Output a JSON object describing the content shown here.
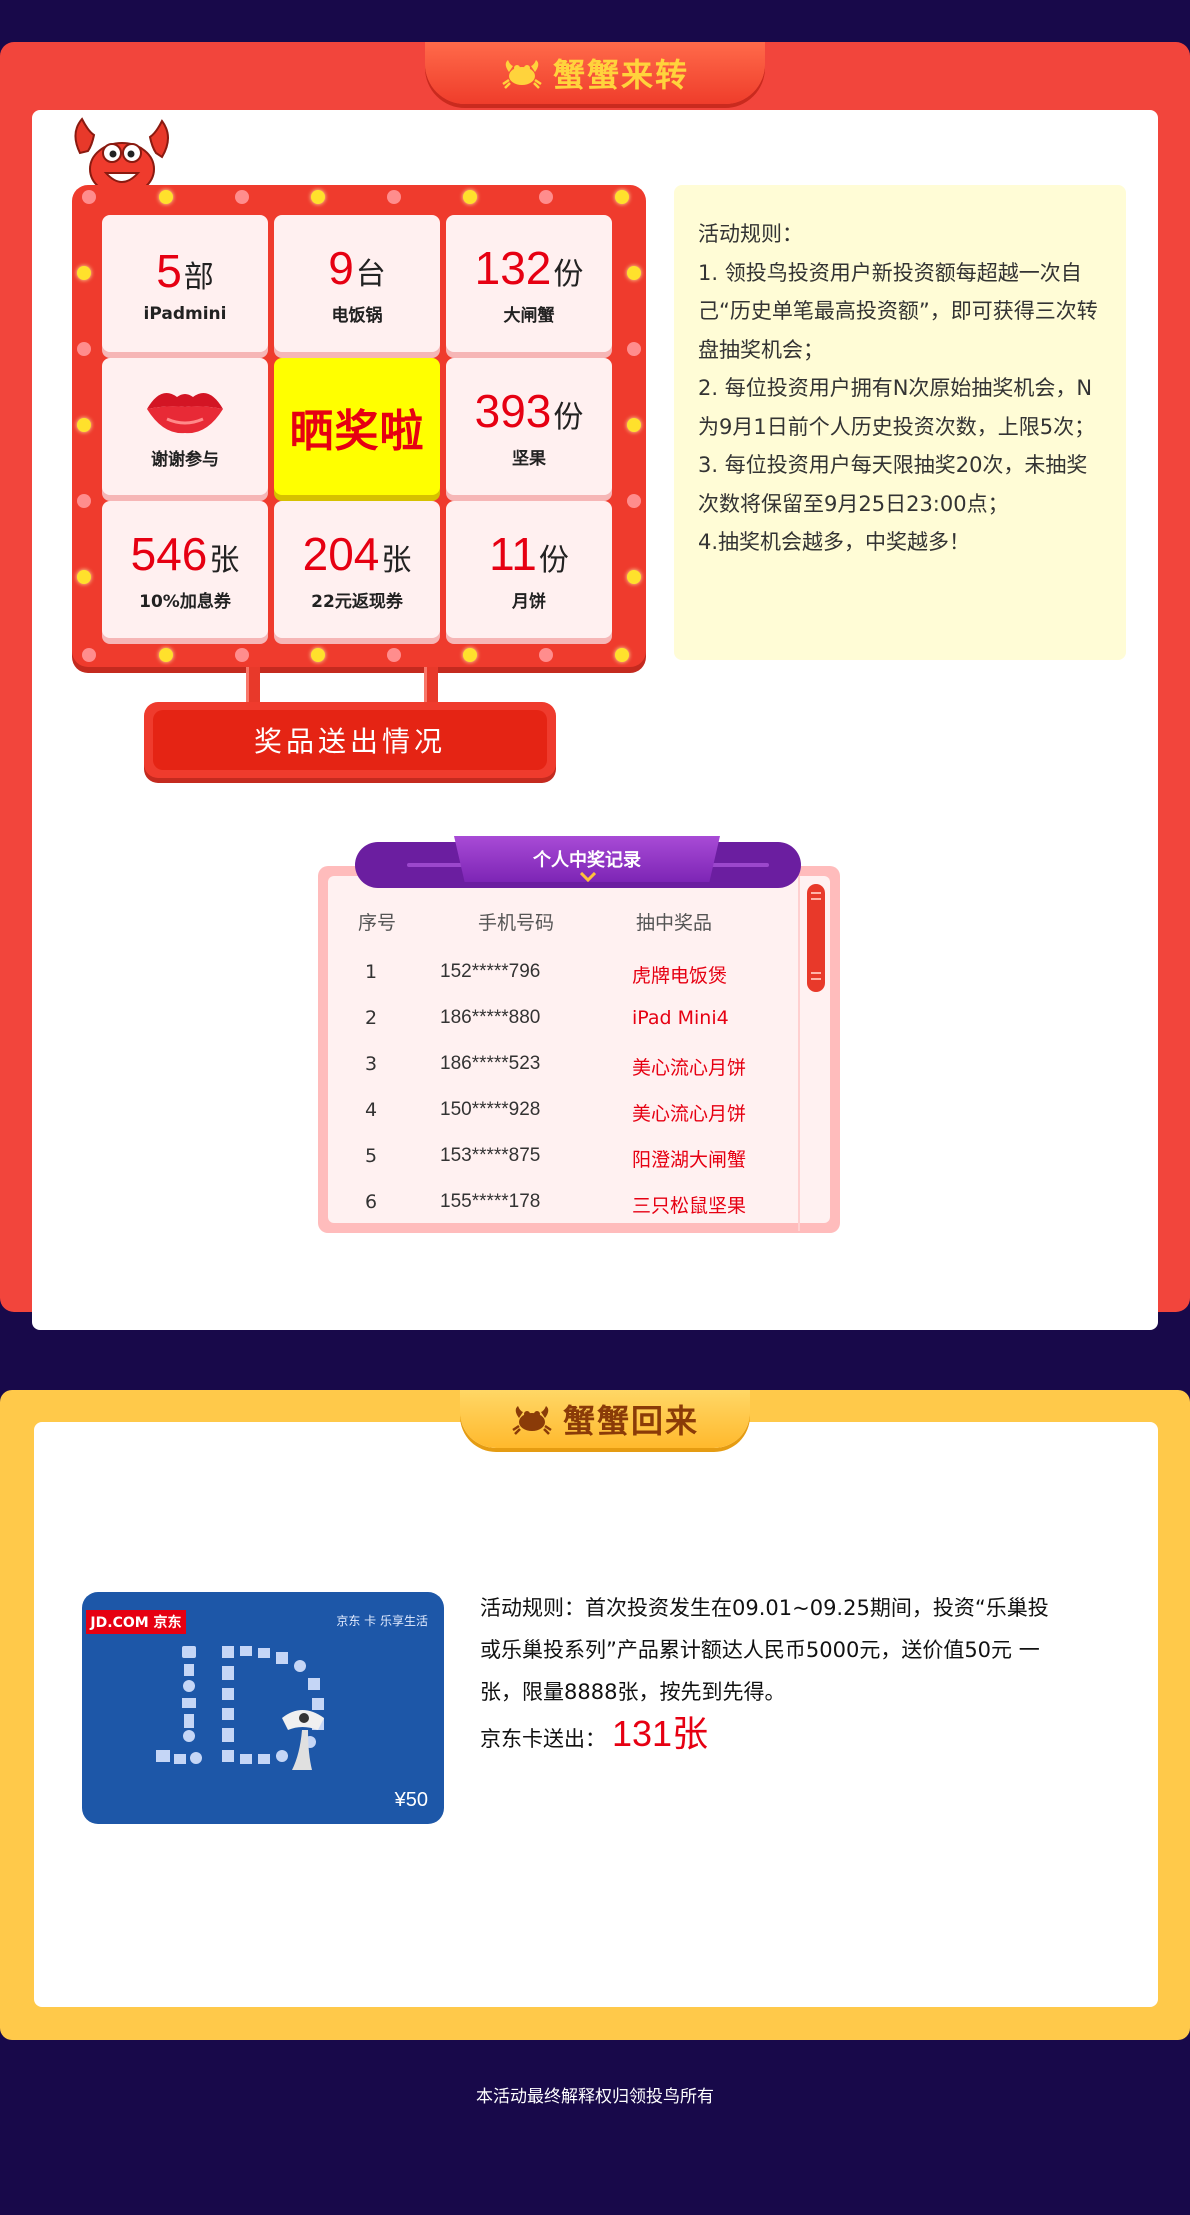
{
  "section1": {
    "title": "蟹蟹来转",
    "prizes": [
      {
        "num": "5",
        "unit": "部",
        "name": "iPadmini"
      },
      {
        "num": "9",
        "unit": "台",
        "name": "电饭锅"
      },
      {
        "num": "132",
        "unit": "份",
        "name": "大闸蟹"
      },
      {
        "num": "",
        "unit": "",
        "name": "谢谢参与",
        "icon": "lips-icon"
      },
      {
        "center": "晒奖啦"
      },
      {
        "num": "393",
        "unit": "份",
        "name": "坚果"
      },
      {
        "num": "546",
        "unit": "张",
        "name": "10%加息券"
      },
      {
        "num": "204",
        "unit": "张",
        "name": "22元返现券"
      },
      {
        "num": "11",
        "unit": "份",
        "name": "月饼"
      }
    ],
    "prize_button": "奖品送出情况",
    "rules": {
      "heading": "活动规则：",
      "items": [
        "1. 领投鸟投资用户新投资额每超越一次自己“历史单笔最高投资额”，即可获得三次转盘抽奖机会；",
        "2. 每位投资用户拥有N次原始抽奖机会，N为9月1日前个人历史投资次数，上限5次；",
        "3. 每位投资用户每天限抽奖20次，未抽奖次数将保留至9月25日23:00点；",
        "4.抽奖机会越多，中奖越多！"
      ]
    },
    "records": {
      "title": "个人中奖记录",
      "columns": [
        "序号",
        "手机号码",
        "抽中奖品"
      ],
      "rows": [
        {
          "idx": "1",
          "phone": "152*****796",
          "prize": "虎牌电饭煲"
        },
        {
          "idx": "2",
          "phone": "186*****880",
          "prize": "iPad Mini4"
        },
        {
          "idx": "3",
          "phone": "186*****523",
          "prize": "美心流心月饼"
        },
        {
          "idx": "4",
          "phone": "150*****928",
          "prize": "美心流心月饼"
        },
        {
          "idx": "5",
          "phone": "153*****875",
          "prize": "阳澄湖大闸蟹"
        },
        {
          "idx": "6",
          "phone": "155*****178",
          "prize": "三只松鼠坚果"
        }
      ]
    }
  },
  "section2": {
    "title": "蟹蟹回来",
    "card": {
      "logo": "JD.COM 京东",
      "slogan": "京东 卡 乐享生活",
      "amount": "¥50"
    },
    "rule_lines": [
      "活动规则：首次投资发生在09.01~09.25期间，投资“乐巢投",
      "或乐巢投系列”产品累计额达人民币5000元，送价值50元 一",
      "张，限量8888张，按先到先得。"
    ],
    "sent_label": "京东卡送出：",
    "sent_count": "131张"
  },
  "footer": "本活动最终解释权归领投鸟所有",
  "colors": {
    "bg": "#18094a",
    "red": "#f2453c",
    "yellow": "#ffc94a",
    "prize_red": "#e60012",
    "purple": "#6b1ea0"
  }
}
